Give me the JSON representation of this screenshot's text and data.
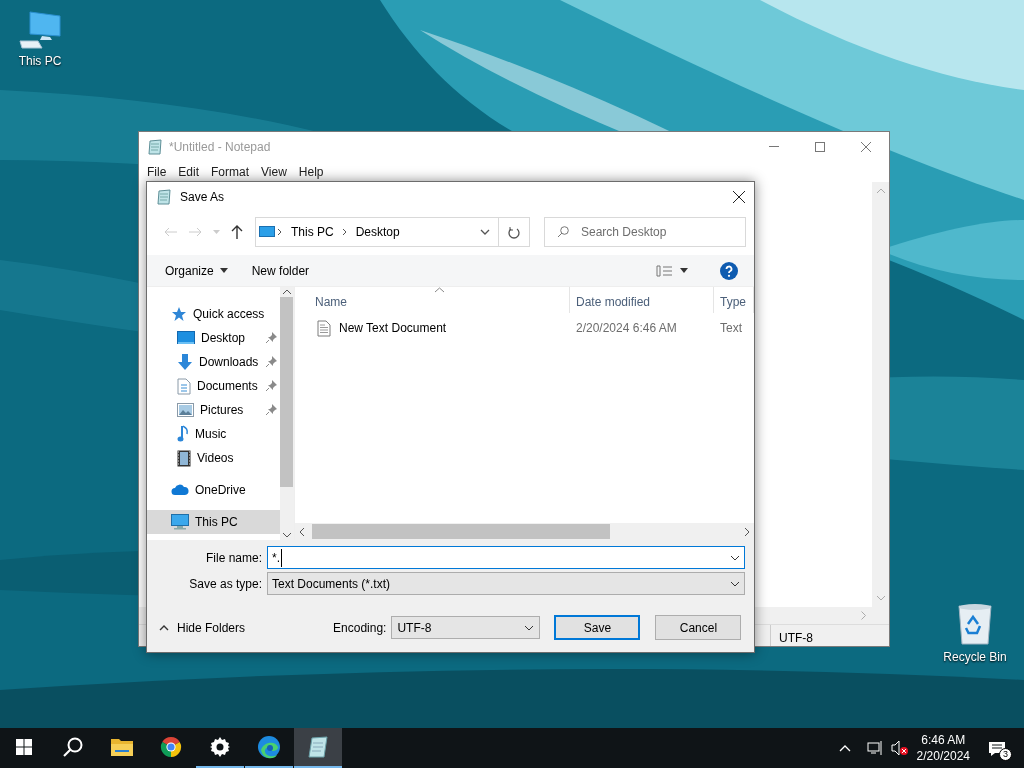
{
  "desktop_icons": [
    {
      "label": "This PC",
      "kind": "computer"
    },
    {
      "label": "Recycle Bin",
      "kind": "recycle"
    }
  ],
  "notepad": {
    "title": "*Untitled - Notepad",
    "active": false,
    "menu": [
      "File",
      "Edit",
      "Format",
      "View",
      "Help"
    ],
    "status_bar": {
      "encoding": "UTF-8"
    }
  },
  "save_as": {
    "title": "Save As",
    "breadcrumb": [
      "This PC",
      "Desktop"
    ],
    "search": {
      "placeholder": "Search Desktop"
    },
    "toolbar": {
      "organize": "Organize",
      "new_folder": "New folder"
    },
    "nav_pane": [
      {
        "label": "Quick access",
        "kind": "star",
        "selected": false,
        "children": [
          {
            "label": "Desktop",
            "kind": "desktop",
            "pinned": true,
            "selected": false
          },
          {
            "label": "Downloads",
            "kind": "downloads",
            "pinned": true,
            "selected": false
          },
          {
            "label": "Documents",
            "kind": "documents",
            "pinned": true,
            "selected": false
          },
          {
            "label": "Pictures",
            "kind": "pictures",
            "pinned": true,
            "selected": false
          },
          {
            "label": "Music",
            "kind": "music",
            "pinned": false,
            "selected": false
          },
          {
            "label": "Videos",
            "kind": "videos",
            "pinned": false,
            "selected": false
          }
        ]
      },
      {
        "label": "OneDrive",
        "kind": "cloud",
        "selected": false
      },
      {
        "label": "This PC",
        "kind": "computer",
        "selected": true
      }
    ],
    "columns": [
      "Name",
      "Date modified",
      "Type"
    ],
    "files": [
      {
        "name": "New Text Document",
        "date_modified": "2/20/2024 6:46 AM",
        "type": "Text"
      }
    ],
    "file_name": {
      "label": "File name:",
      "value": "*.",
      "focused": true
    },
    "save_as_type": {
      "label": "Save as type:",
      "value": "Text Documents (*.txt)"
    },
    "hide_folders": "Hide Folders",
    "encoding": {
      "label": "Encoding:",
      "value": "UTF-8"
    },
    "buttons": [
      {
        "label": "Save",
        "kind": "default"
      },
      {
        "label": "Cancel",
        "kind": "normal"
      }
    ]
  },
  "taskbar": {
    "apps": [
      {
        "kind": "start",
        "running": false,
        "selected": false
      },
      {
        "kind": "search",
        "running": false,
        "selected": false
      },
      {
        "kind": "folder",
        "running": false,
        "selected": false
      },
      {
        "kind": "chrome",
        "running": false,
        "selected": false
      },
      {
        "kind": "settings",
        "running": true,
        "selected": false
      },
      {
        "kind": "edge",
        "running": true,
        "selected": false
      },
      {
        "kind": "notepad",
        "running": true,
        "selected": true
      }
    ],
    "time": "6:46 AM",
    "date": "2/20/2024",
    "notifications": "3"
  }
}
